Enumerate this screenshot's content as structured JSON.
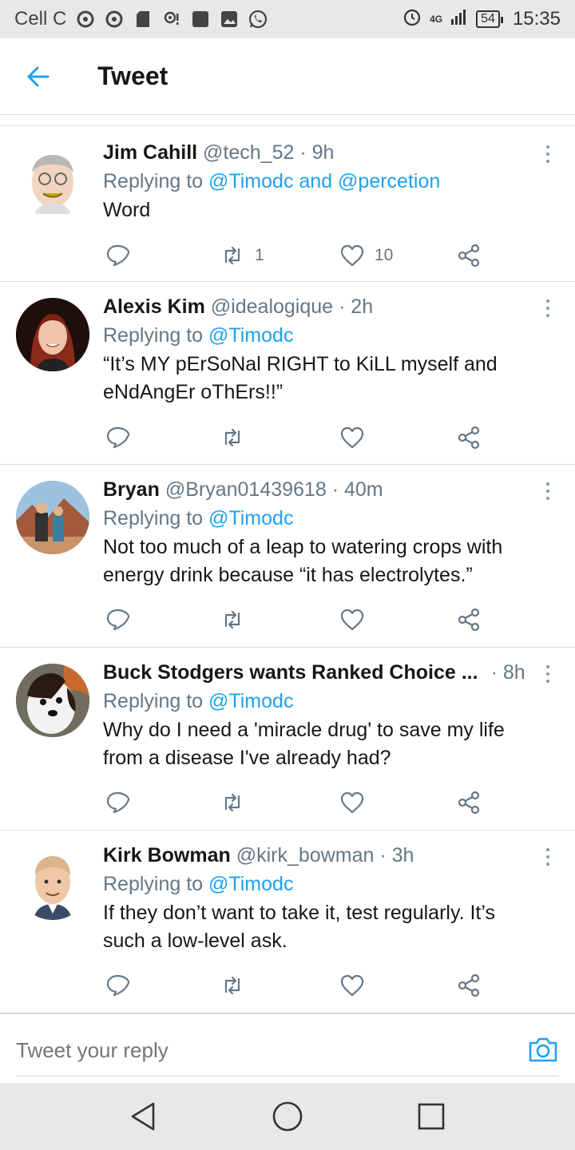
{
  "status_bar": {
    "carrier": "Cell C",
    "network": "4G",
    "battery": "54",
    "time": "15:35",
    "icons": [
      "cell-c-icon",
      "cell-c-icon",
      "sd-card-icon",
      "location-icon",
      "square-icon",
      "image-icon",
      "whatsapp-icon",
      "alarm-icon",
      "signal-icon",
      "battery-icon"
    ]
  },
  "header": {
    "title": "Tweet",
    "back_icon": "arrow-left-icon"
  },
  "colors": {
    "accent": "#1da1f2",
    "secondary_text": "#657786",
    "primary_text": "#14171a"
  },
  "tweets": [
    {
      "name": "Jim Cahill",
      "handle": "@tech_52",
      "time": "· 9h",
      "reply_prefix": "Replying to",
      "mentions": "@Timodc and @percetion",
      "text": "Word",
      "retweets": "1",
      "likes": "10"
    },
    {
      "name": "Alexis Kim",
      "handle": "@idealogique",
      "time": "· 2h",
      "reply_prefix": "Replying to",
      "mentions": "@Timodc",
      "text": "“It’s MY pErSoNal RIGHT to KiLL myself and eNdAngEr oThErs!!”",
      "retweets": "",
      "likes": ""
    },
    {
      "name": "Bryan",
      "handle": "@Bryan01439618",
      "time": "· 40m",
      "reply_prefix": "Replying to",
      "mentions": "@Timodc",
      "text": "Not too much of a leap to watering crops with energy drink because “it has electrolytes.”",
      "retweets": "",
      "likes": ""
    },
    {
      "name": "Buck Stodgers wants Ranked Choice ...",
      "handle": "",
      "time": "· 8h",
      "reply_prefix": "Replying to",
      "mentions": "@Timodc",
      "text": "Why do I need a 'miracle drug' to save my life from a disease I've already had?",
      "retweets": "",
      "likes": ""
    },
    {
      "name": "Kirk Bowman",
      "handle": "@kirk_bowman",
      "time": "· 3h",
      "reply_prefix": "Replying to",
      "mentions": "@Timodc",
      "text": "If they don’t want to take it, test regularly. It’s such a low-level ask.",
      "retweets": "",
      "likes": ""
    }
  ],
  "reply_bar": {
    "placeholder": "Tweet your reply",
    "camera_icon": "camera-icon"
  },
  "nav_bar": {
    "icons": [
      "back-triangle-icon",
      "home-circle-icon",
      "recents-square-icon"
    ]
  }
}
